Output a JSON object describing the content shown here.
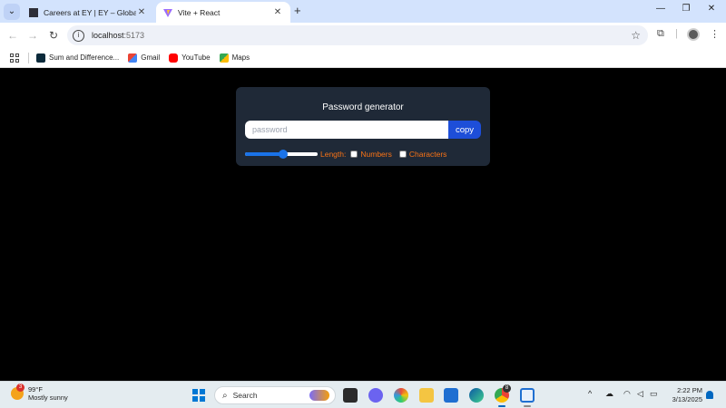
{
  "browser": {
    "tabs": [
      {
        "title": "Careers at EY | EY – Global | EY",
        "active": false
      },
      {
        "title": "Vite + React",
        "active": true
      }
    ],
    "address": {
      "host": "localhost",
      "port": ":5173"
    },
    "bookmarks": [
      {
        "label": "Sum and Difference..."
      },
      {
        "label": "Gmail"
      },
      {
        "label": "YouTube"
      },
      {
        "label": "Maps"
      }
    ]
  },
  "app": {
    "title": "Password generator",
    "password": {
      "value": "",
      "placeholder": "password"
    },
    "copy_label": "copy",
    "length": {
      "label": "Length: ",
      "slider_fraction": 0.52
    },
    "options": {
      "numbers": {
        "label": "Numbers",
        "checked": false
      },
      "characters": {
        "label": "Characters",
        "checked": false
      }
    },
    "colors": {
      "card": "#1f2937",
      "accent": "#1d4ed8",
      "option_text": "#f97316"
    }
  },
  "taskbar": {
    "weather": {
      "temp": "99°F",
      "condition": "Mostly sunny",
      "badge": "3"
    },
    "search_label": "Search",
    "clock": {
      "time": "2:22 PM",
      "date": "3/13/2025"
    },
    "chrome_badge": "8"
  }
}
